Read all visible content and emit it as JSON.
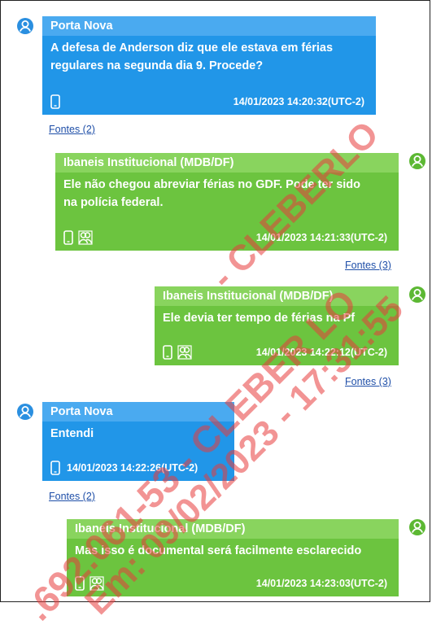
{
  "messages": [
    {
      "sender": "Porta Nova",
      "text_lines": [
        "A defesa de Anderson diz que ele estava em férias",
        "regulares na segunda dia 9. Procede?"
      ],
      "timestamp": "14/01/2023 14:20:32(UTC-2)",
      "sources_link": "Fontes (2)",
      "side": "left",
      "color": "#2196e8"
    },
    {
      "sender": "Ibaneis Institucional (MDB/DF)",
      "text_lines": [
        "Ele não chegou abreviar férias no GDF. Pode ter sido",
        "na polícia federal."
      ],
      "timestamp": "14/01/2023 14:21:33(UTC-2)",
      "sources_link": "Fontes (3)",
      "side": "right",
      "color": "#6cc43f"
    },
    {
      "sender": "Ibaneis Institucional (MDB/DF)",
      "text_lines": [
        "Ele devia ter tempo de férias na Pf"
      ],
      "timestamp": "14/01/2023 14:22:12(UTC-2)",
      "sources_link": "Fontes (3)",
      "side": "right",
      "color": "#6cc43f"
    },
    {
      "sender": "Porta Nova",
      "text_lines": [
        "Entendi"
      ],
      "timestamp": "14/01/2023 14:22:26(UTC-2)",
      "sources_link": "Fontes (2)",
      "side": "left",
      "color": "#2196e8"
    },
    {
      "sender": "Ibaneis Institucional (MDB/DF)",
      "text_lines": [
        "Mas isso é documental será facilmente esclarecido"
      ],
      "timestamp": "14/01/2023 14:23:03(UTC-2)",
      "sources_link": "",
      "side": "right",
      "color": "#6cc43f"
    }
  ],
  "watermark": {
    "line1": "- CLEBERLO",
    "line2": ".692.061-53 - CLEBER LO",
    "line3": "Em: 09/02/2023 - 17:31:55"
  },
  "icons": {
    "avatar": "user-icon",
    "device": "phone-icon",
    "participants": "group-icon"
  }
}
